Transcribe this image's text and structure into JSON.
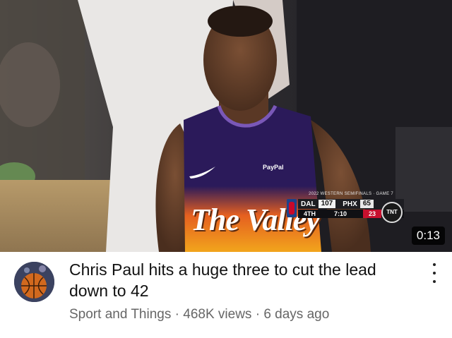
{
  "video": {
    "duration": "0:13",
    "jersey_sponsor": "PayPal",
    "jersey_wordmark": "The Valley",
    "scorebug": {
      "title": "2022 WESTERN SEMIFINALS · GAME 7",
      "away_team": "DAL",
      "away_score": "107",
      "home_team": "PHX",
      "home_score": "65",
      "period": "4TH",
      "clock": "7:10",
      "shot_clock": "23",
      "network": "TNT"
    }
  },
  "meta": {
    "title": "Chris Paul hits a huge three to cut the lead down to 42",
    "channel": "Sport and Things",
    "views": "468K views",
    "age": "6 days ago",
    "separator": "·"
  },
  "icons": {
    "menu": "kebab-menu-icon",
    "avatar": "basketball-avatar-icon"
  },
  "colors": {
    "suns_purple": "#2b1a5a",
    "suns_orange": "#e56020",
    "text_primary": "#111111",
    "text_secondary": "#666666"
  }
}
